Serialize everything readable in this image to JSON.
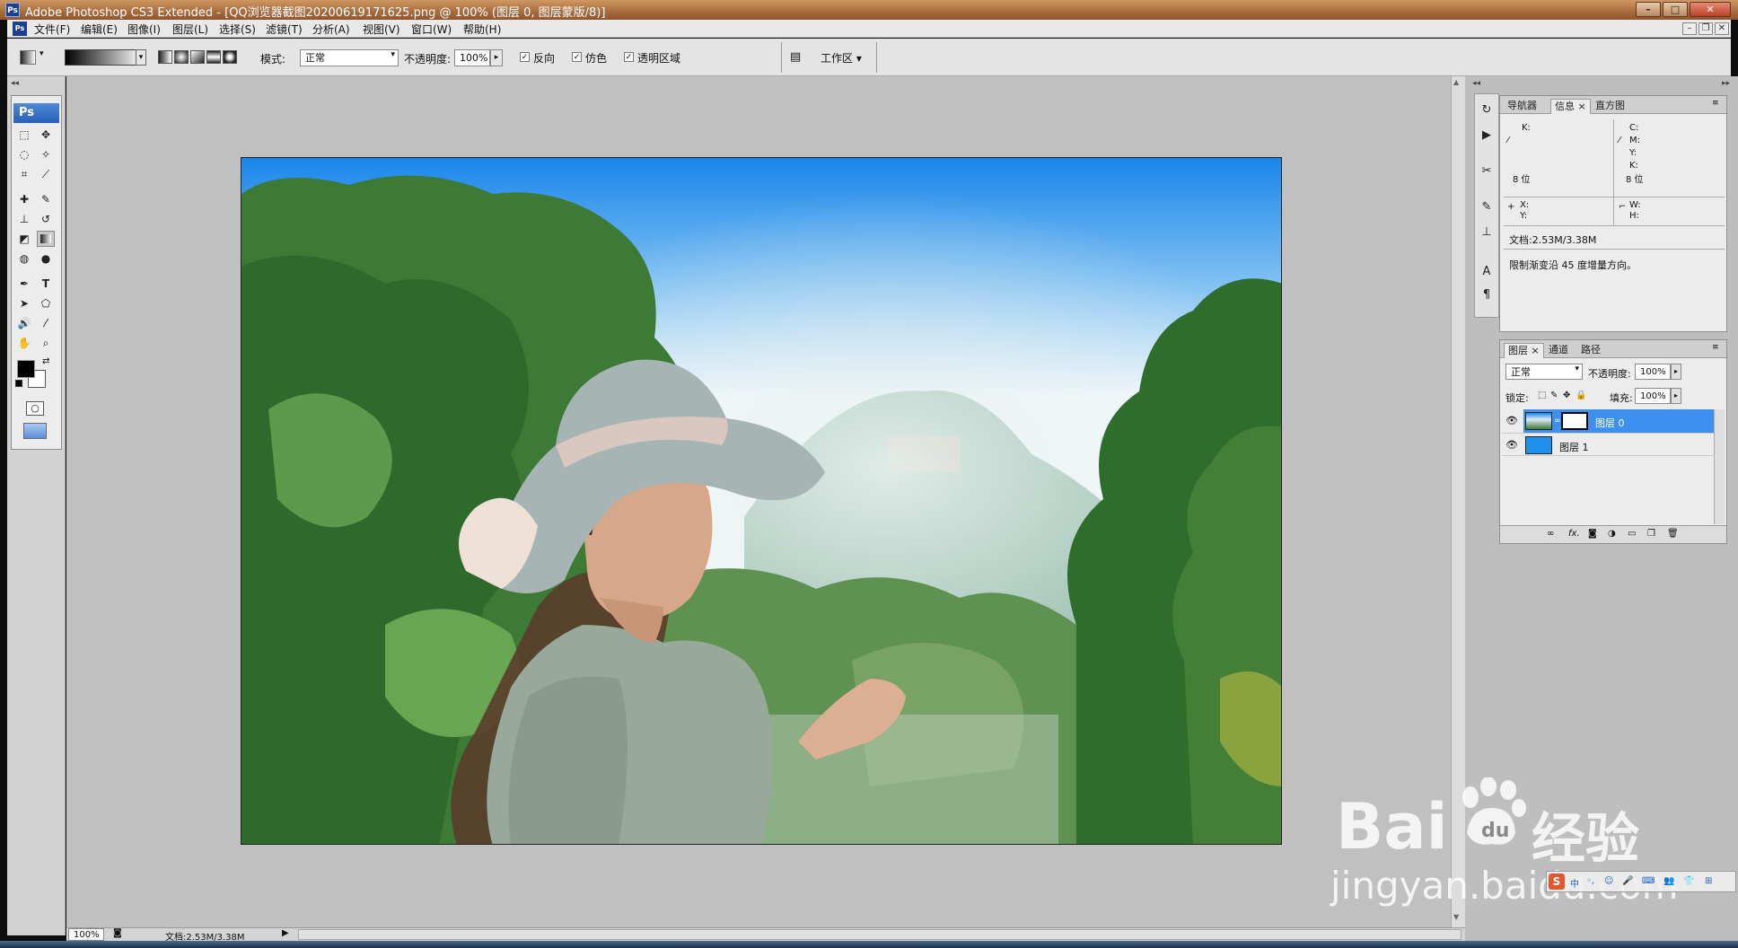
{
  "window": {
    "title": "Adobe Photoshop CS3 Extended - [QQ浏览器截图20200619171625.png @ 100% (图层 0, 图层蒙版/8)]",
    "app_icon": "Ps",
    "controls": [
      "minimize-icon",
      "maximize-icon",
      "close-icon"
    ]
  },
  "menu": {
    "items": [
      "文件(F)",
      "编辑(E)",
      "图像(I)",
      "图层(L)",
      "选择(S)",
      "滤镜(T)",
      "分析(A)",
      "视图(V)",
      "窗口(W)",
      "帮助(H)"
    ]
  },
  "options": {
    "mode_label": "模式:",
    "mode_value": "正常",
    "opacity_label": "不透明度:",
    "opacity_value": "100%",
    "reverse_label": "反向",
    "reverse_checked": true,
    "dither_label": "仿色",
    "dither_checked": true,
    "transparency_label": "透明区域",
    "transparency_checked": true,
    "workspace_label": "工作区 ▾"
  },
  "toolbox": {
    "header": "Ps",
    "foreground_color": "#000000",
    "background_color": "#ffffff"
  },
  "info_panel": {
    "tabs": [
      "导航器",
      "信息",
      "直方图"
    ],
    "active_tab": "信息",
    "k_label": "K:",
    "c_label": "C:",
    "m_label": "M:",
    "y_label": "Y:",
    "k2_label": "K:",
    "bits_left": "8 位",
    "bits_right": "8 位",
    "x_label": "X:",
    "y_coord_label": "Y:",
    "w_label": "W:",
    "h_label": "H:",
    "doc_size": "文档:2.53M/3.38M",
    "hint": "限制渐变沿 45 度增量方向。"
  },
  "layers_panel": {
    "tabs": [
      "图层",
      "通道",
      "路径"
    ],
    "active_tab": "图层",
    "blend_mode": "正常",
    "opacity_label": "不透明度:",
    "opacity_value": "100%",
    "lock_label": "锁定:",
    "fill_label": "填充:",
    "fill_value": "100%",
    "layers": [
      {
        "name": "图层 0",
        "selected": true
      },
      {
        "name": "图层 1",
        "selected": false
      }
    ]
  },
  "status": {
    "zoom": "100%",
    "doc": "文档:2.53M/3.38M"
  },
  "watermark": {
    "brand_left": "Bai",
    "brand_right": "经验",
    "url": "jingyan.baidu.com"
  },
  "colors": {
    "selection_blue": "#3d8ff0",
    "sky_blue": "#2090ee",
    "foliage_green": "#3f7a34"
  }
}
